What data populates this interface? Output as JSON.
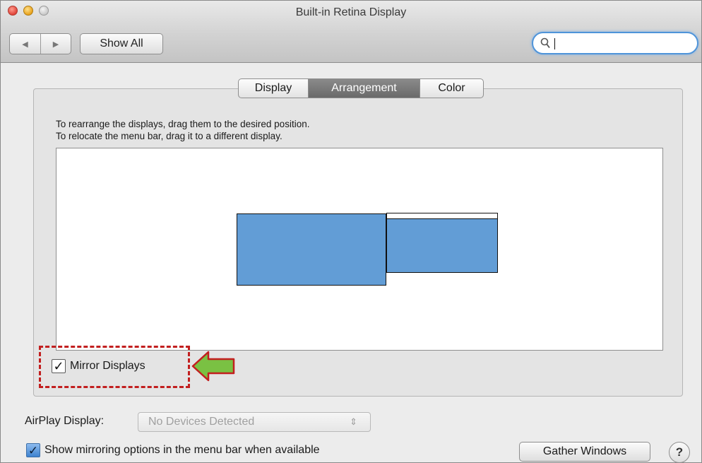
{
  "window": {
    "title": "Built-in Retina Display"
  },
  "toolbar": {
    "back_icon": "◀",
    "forward_icon": "▶",
    "show_all_label": "Show All",
    "search_value": ""
  },
  "tabs": [
    {
      "label": "Display",
      "active": false
    },
    {
      "label": "Arrangement",
      "active": true
    },
    {
      "label": "Color",
      "active": false
    }
  ],
  "instructions": {
    "line1": "To rearrange the displays, drag them to the desired position.",
    "line2": "To relocate the menu bar, drag it to a different display."
  },
  "mirror_displays": {
    "label": "Mirror Displays",
    "checked": true,
    "checkmark": "✓"
  },
  "airplay": {
    "label": "AirPlay Display:",
    "selected": "No Devices Detected",
    "arrows": "⇕"
  },
  "show_mirroring": {
    "label": "Show mirroring options in the menu bar when available",
    "checked": true,
    "checkmark": "✓"
  },
  "buttons": {
    "gather_windows": "Gather Windows",
    "help": "?"
  },
  "colors": {
    "display_fill": "#629dd6",
    "highlight_red": "#c21f1f",
    "arrow_green": "#7ac143"
  }
}
